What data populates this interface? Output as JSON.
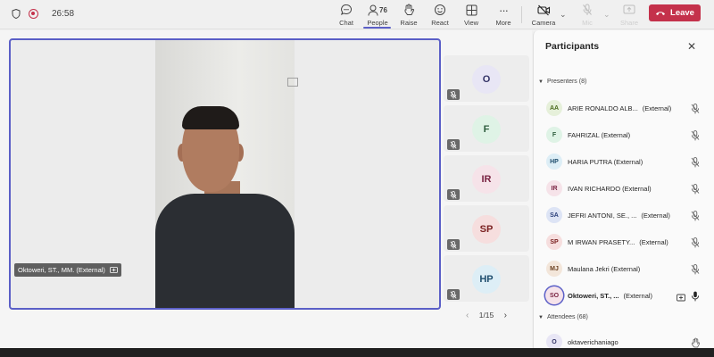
{
  "header": {
    "timer": "26:58",
    "tools": {
      "chat": "Chat",
      "people": "People",
      "people_count": "76",
      "raise": "Raise",
      "react": "React",
      "view": "View",
      "more": "More",
      "camera": "Camera",
      "mic": "Mic",
      "share": "Share"
    },
    "leave": "Leave"
  },
  "stage": {
    "speaker_name": "Oktoweri, ST., MM. (External)",
    "tiles": [
      {
        "initials": "O",
        "bg": "#e8e6f5",
        "fg": "#333366"
      },
      {
        "initials": "F",
        "bg": "#dff3e6",
        "fg": "#2f5e3e"
      },
      {
        "initials": "IR",
        "bg": "#f6e3e9",
        "fg": "#7a2443"
      },
      {
        "initials": "SP",
        "bg": "#f6dede",
        "fg": "#7a2020"
      },
      {
        "initials": "HP",
        "bg": "#ddeef6",
        "fg": "#1f4e6e"
      }
    ],
    "pager": "1/15"
  },
  "panel": {
    "title": "Participants",
    "presenters_label": "Presenters (8)",
    "attendees_label": "Attendees (68)",
    "presenters": [
      {
        "initials": "AA",
        "name": "ARIE RONALDO ALB...",
        "ext": "(External)",
        "bg": "#e6f0da",
        "fg": "#4b6b1e"
      },
      {
        "initials": "F",
        "name": "FAHRIZAL (External)",
        "ext": "",
        "bg": "#dff3e6",
        "fg": "#2f5e3e"
      },
      {
        "initials": "HP",
        "name": "HARIA PUTRA (External)",
        "ext": "",
        "bg": "#ddeef6",
        "fg": "#1f4e6e"
      },
      {
        "initials": "IR",
        "name": "IVAN RICHARDO (External)",
        "ext": "",
        "bg": "#f6e3e9",
        "fg": "#7a2443"
      },
      {
        "initials": "SA",
        "name": "JEFRI ANTONI, SE., ...",
        "ext": "(External)",
        "bg": "#dde4f5",
        "fg": "#2a3f7a"
      },
      {
        "initials": "SP",
        "name": "M IRWAN PRASETY...",
        "ext": "(External)",
        "bg": "#f6dede",
        "fg": "#7a2020"
      },
      {
        "initials": "MJ",
        "name": "Maulana Jekri (External)",
        "ext": "",
        "bg": "#f3e6da",
        "fg": "#6b4020"
      },
      {
        "initials": "SO",
        "name": "Oktoweri, ST., ...",
        "ext": "(External)",
        "bg": "#f6e3ea",
        "fg": "#7a2443"
      }
    ],
    "attendees": [
      {
        "initials": "O",
        "name": "oktaverichaniago",
        "ext": "",
        "bg": "#e8e6f5",
        "fg": "#333366"
      }
    ]
  }
}
